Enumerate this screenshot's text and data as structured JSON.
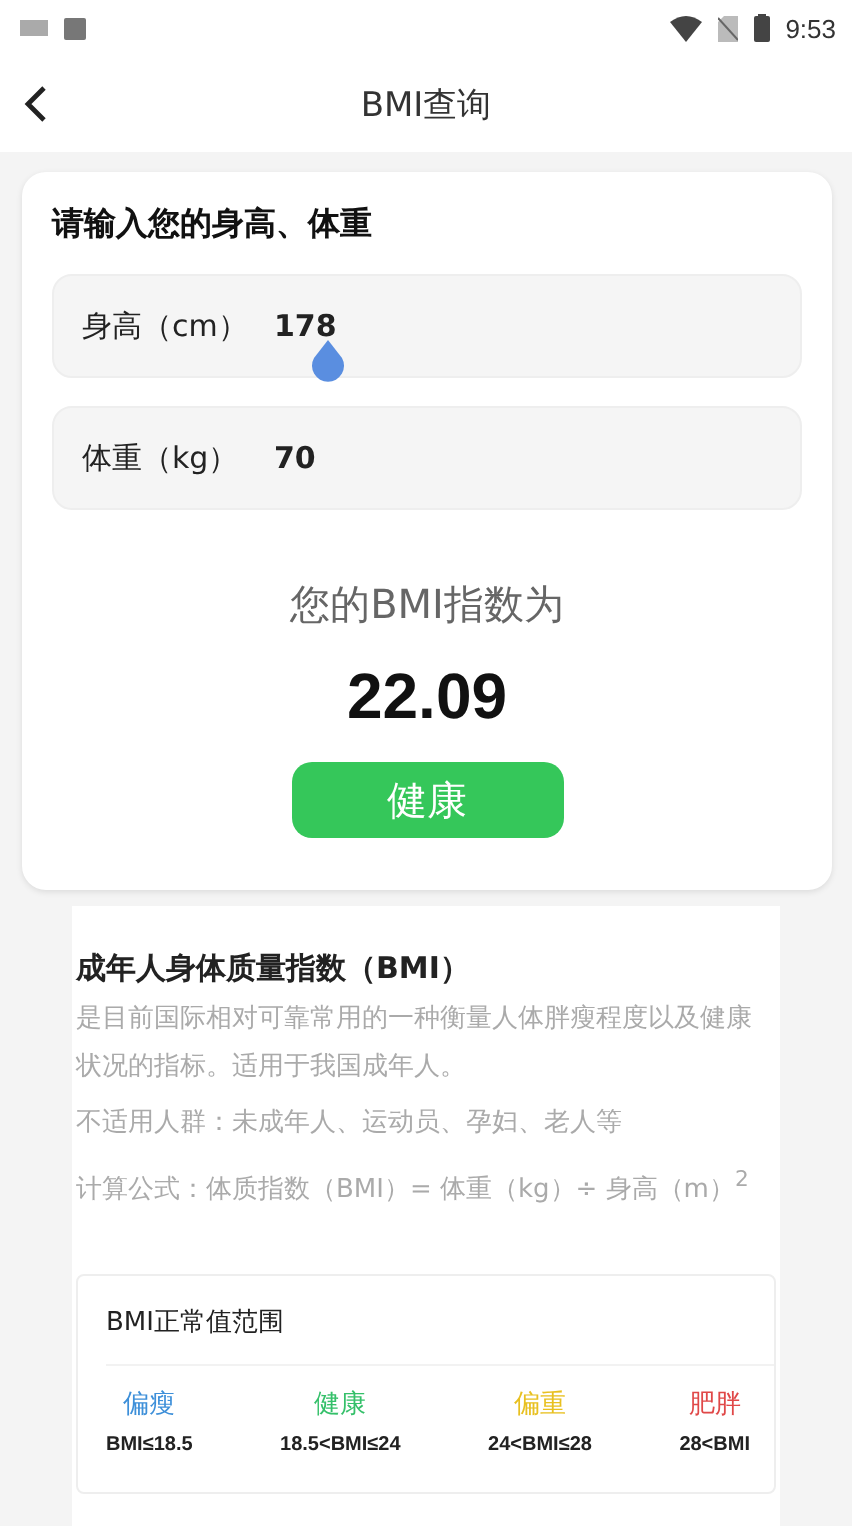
{
  "status_bar": {
    "time": "9:53"
  },
  "header": {
    "title": "BMI查询"
  },
  "input_card": {
    "title": "请输入您的身高、体重",
    "fields": [
      {
        "label": "身高（cm）",
        "value": "178",
        "focused": true
      },
      {
        "label": "体重（kg）",
        "value": "70",
        "focused": false
      }
    ],
    "result_label": "您的BMI指数为",
    "result_value": "22.09",
    "status": "健康"
  },
  "info": {
    "title": "成年人身体质量指数（BMI）",
    "paragraphs": [
      "是目前国际相对可靠常用的一种衡量人体胖瘦程度以及健康状况的指标。适用于我国成年人。",
      "不适用人群：未成年人、运动员、孕妇、老人等",
      "计算公式：体质指数（BMI）= 体重（kg）÷ 身高（m）$^{2}$"
    ],
    "range_card": {
      "title": "BMI正常值范围",
      "ranges": [
        {
          "name": "偏瘦",
          "range": "BMI≤18.5",
          "color": "#3d8fd9"
        },
        {
          "name": "健康",
          "range": "18.5<BMI≤24",
          "color": "#35c06a"
        },
        {
          "name": "偏重",
          "range": "24<BMI≤28",
          "color": "#e8c020"
        },
        {
          "name": "肥胖",
          "range": "28<BMI",
          "color": "#e04848"
        }
      ]
    }
  }
}
